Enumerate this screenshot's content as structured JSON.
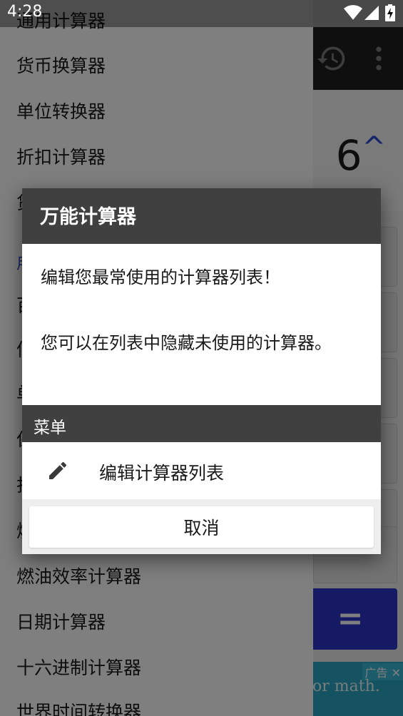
{
  "status_bar": {
    "time": "4:28"
  },
  "drawer": {
    "items": [
      "通用计算器",
      "货币换算器",
      "单位转换器",
      "折扣计算器",
      "贷",
      "百",
      "信",
      "单",
      "保",
      "折",
      "燃",
      "燃油效率计算器",
      "日期计算器",
      "十六进制计算器",
      "世界时间转换器"
    ],
    "section_label": "用"
  },
  "app": {
    "display_value": "6",
    "equals_label": "=",
    "ad_label": "广告",
    "ad_text": "or math."
  },
  "dialog": {
    "title": "万能计算器",
    "message_line1": "编辑您最常使用的计算器列表！",
    "message_line2": "您可以在列表中隐藏未使用的计算器。",
    "menu_header": "菜单",
    "menu_item_edit": "编辑计算器列表",
    "cancel_label": "取消"
  },
  "icons": {
    "history": "history-icon",
    "more": "more-vert-icon",
    "edit": "pencil-icon",
    "wifi": "wifi-icon",
    "signal": "signal-icon",
    "battery": "battery-charging-icon",
    "ad_close": "close-icon"
  },
  "colors": {
    "accent": "#2a4bd0",
    "dialog_header": "#404040",
    "equals_key": "#2c35c9",
    "ad_background": "#2aa7c4"
  }
}
